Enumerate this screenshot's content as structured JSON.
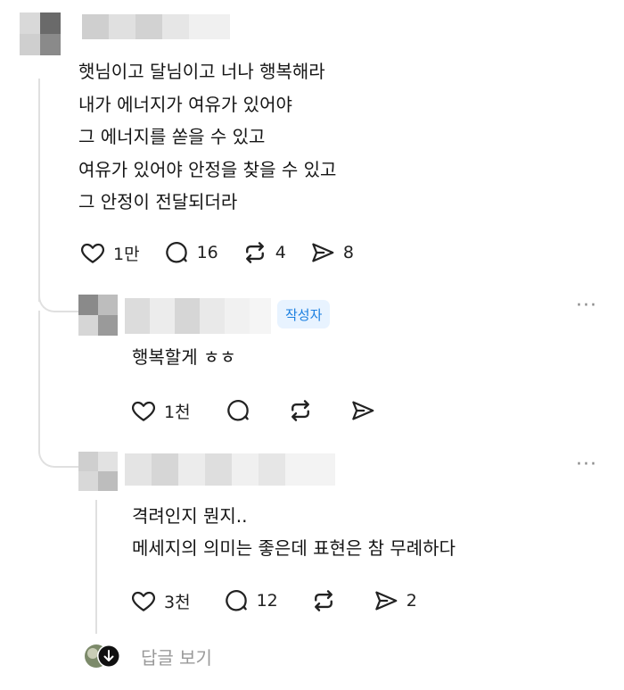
{
  "post": {
    "lines": [
      "햇님이고 달님이고 너나 행복해라",
      "내가 에너지가 여유가 있어야",
      "그 에너지를 쏟을 수 있고",
      "여유가 있어야 안정을 찾을 수 있고",
      "그 안정이 전달되더라"
    ],
    "likes": "1만",
    "comments": "16",
    "reposts": "4",
    "shares": "8"
  },
  "reply1": {
    "badge": "작성자",
    "text": "행복할게 ㅎㅎ",
    "likes": "1천",
    "more": "···"
  },
  "reply2": {
    "lines": [
      "격려인지 뭔지..",
      "메세지의 의미는 좋은데 표현은 참 무례하다"
    ],
    "likes": "3천",
    "comments": "12",
    "shares": "2",
    "more": "···"
  },
  "view_replies": {
    "label": "답글 보기"
  },
  "icons": [
    "heart-icon",
    "comment-icon",
    "repost-icon",
    "send-icon",
    "more-icon",
    "down-arrow-icon"
  ],
  "colors": {
    "badge_bg": "#e8f3ff",
    "badge_text": "#1a7fe0",
    "muted": "#9a9a9a"
  }
}
